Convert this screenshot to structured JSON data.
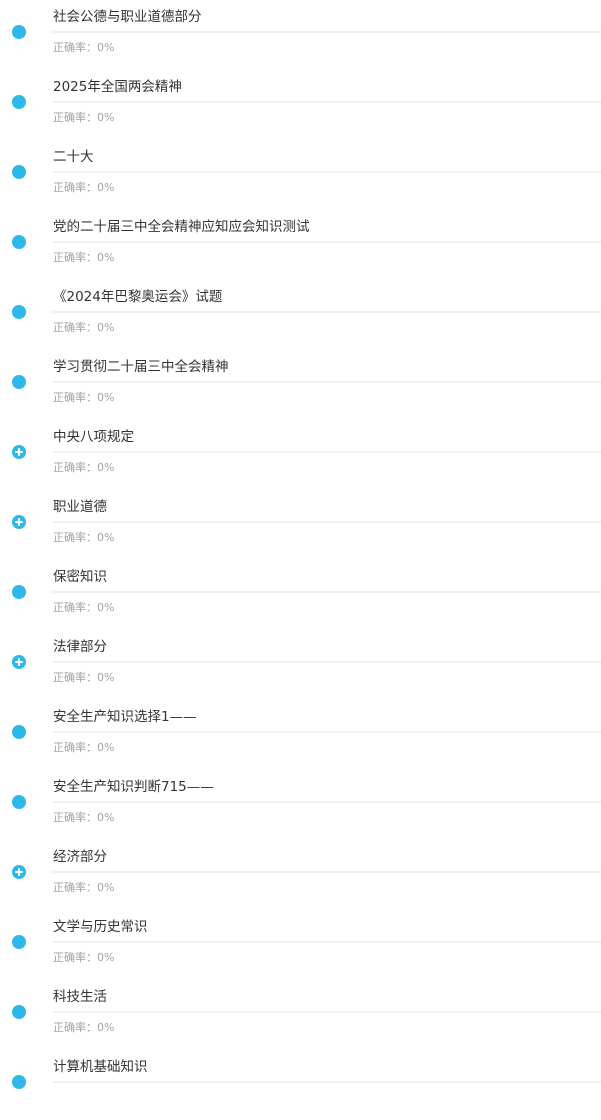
{
  "accuracy_label": "正确率：",
  "accent_color": "#2eb8ea",
  "items": [
    {
      "title": "社会公德与职业道德部分",
      "accuracy": "0%",
      "icon": "dot-icon"
    },
    {
      "title": "2025年全国两会精神",
      "accuracy": "0%",
      "icon": "dot-icon"
    },
    {
      "title": "二十大",
      "accuracy": "0%",
      "icon": "dot-icon"
    },
    {
      "title": "党的二十届三中全会精神应知应会知识测试",
      "accuracy": "0%",
      "icon": "dot-icon"
    },
    {
      "title": "《2024年巴黎奥运会》试题",
      "accuracy": "0%",
      "icon": "dot-icon"
    },
    {
      "title": "学习贯彻二十届三中全会精神",
      "accuracy": "0%",
      "icon": "dot-icon"
    },
    {
      "title": "中央八项规定",
      "accuracy": "0%",
      "icon": "plus-circle-icon"
    },
    {
      "title": "职业道德",
      "accuracy": "0%",
      "icon": "plus-circle-icon"
    },
    {
      "title": "保密知识",
      "accuracy": "0%",
      "icon": "dot-icon"
    },
    {
      "title": "法律部分",
      "accuracy": "0%",
      "icon": "plus-circle-icon"
    },
    {
      "title": "安全生产知识选择1——",
      "accuracy": "0%",
      "icon": "dot-icon"
    },
    {
      "title": "安全生产知识判断715——",
      "accuracy": "0%",
      "icon": "dot-icon"
    },
    {
      "title": "经济部分",
      "accuracy": "0%",
      "icon": "plus-circle-icon"
    },
    {
      "title": "文学与历史常识",
      "accuracy": "0%",
      "icon": "dot-icon"
    },
    {
      "title": "科技生活",
      "accuracy": "0%",
      "icon": "dot-icon"
    },
    {
      "title": "计算机基础知识",
      "accuracy": null,
      "icon": "dot-icon"
    }
  ]
}
